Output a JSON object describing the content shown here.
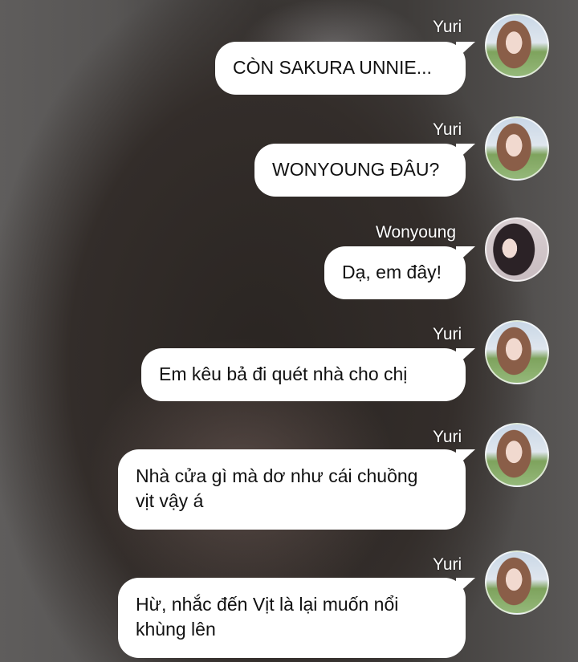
{
  "messages": [
    {
      "sender": "Yuri",
      "text": "CÒN SAKURA UNNIE...",
      "avatar_icon": "yuri-avatar"
    },
    {
      "sender": "Yuri",
      "text": "WONYOUNG ĐÂU?",
      "avatar_icon": "yuri-avatar"
    },
    {
      "sender": "Wonyoung",
      "text": "Dạ, em đây!",
      "avatar_icon": "wonyoung-avatar"
    },
    {
      "sender": "Yuri",
      "text": "Em kêu bả đi quét nhà cho chị",
      "avatar_icon": "yuri-avatar"
    },
    {
      "sender": "Yuri",
      "text": "Nhà cửa gì mà dơ như cái chuồng vịt vậy á",
      "avatar_icon": "yuri-avatar"
    },
    {
      "sender": "Yuri",
      "text": "Hừ, nhắc đến Vịt là lại muốn nổi khùng lên",
      "avatar_icon": "yuri-avatar"
    }
  ],
  "colors": {
    "bubble": "#ffffff",
    "name_text": "#ffffff",
    "message_text": "#111111"
  }
}
